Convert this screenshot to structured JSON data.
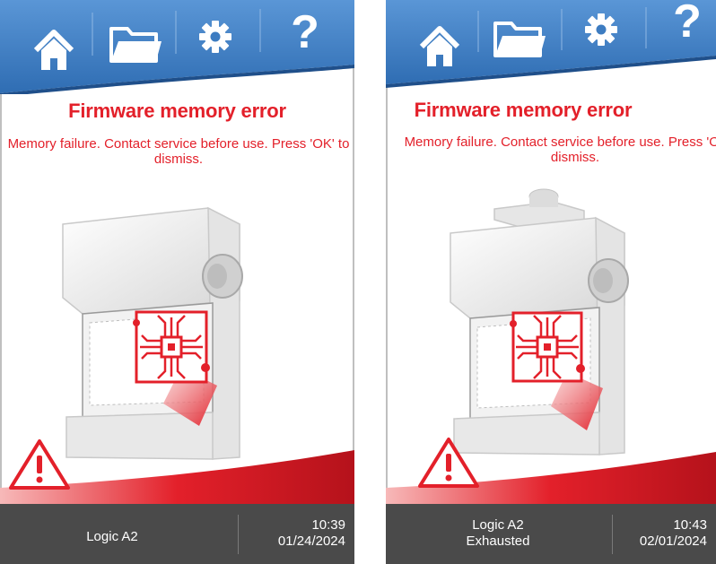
{
  "screens": [
    {
      "nav": {
        "home": "home-icon",
        "folder": "folder-icon",
        "settings": "gear-icon",
        "help_label": "?"
      },
      "error_title": "Firmware memory error",
      "error_message": "Memory failure. Contact service before use. Press 'OK' to dismiss.",
      "footer": {
        "model": "Logic A2",
        "status": "",
        "time": "10:39",
        "date": "01/24/2024"
      }
    },
    {
      "nav": {
        "home": "home-icon",
        "folder": "folder-icon",
        "settings": "gear-icon",
        "help_label": "?"
      },
      "error_title": "Firmware memory error",
      "error_message": "Memory failure. Contact service before use. Press 'OK' to dismiss.",
      "footer": {
        "model": "Logic A2",
        "status": "Exhausted",
        "time": "10:43",
        "date": "02/01/2024"
      }
    }
  ],
  "colors": {
    "accent_blue": "#3d7cc1",
    "error_red": "#e3202a",
    "footer_gray": "#4a4a4a"
  }
}
